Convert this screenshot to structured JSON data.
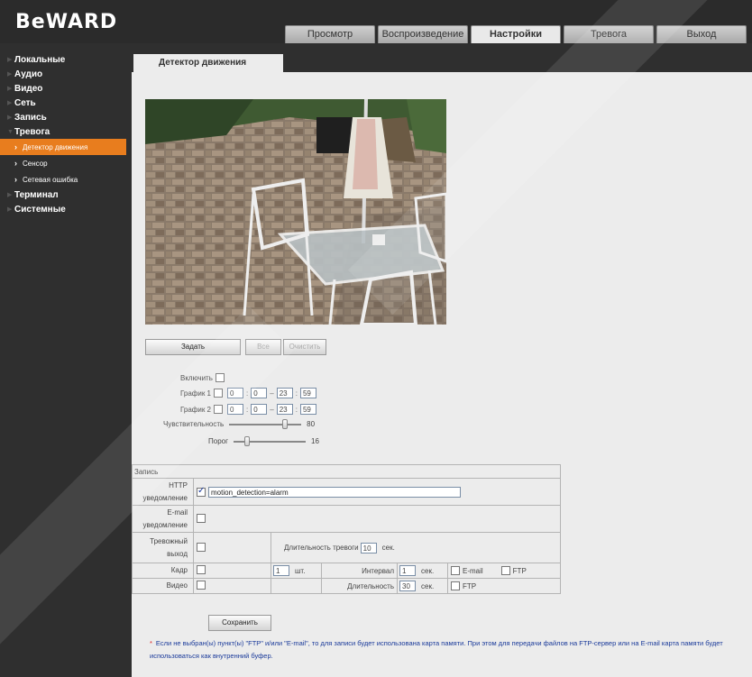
{
  "brand": {
    "logo": "BeWARD"
  },
  "top_tabs": [
    "Просмотр",
    "Воспроизведение",
    "Настройки",
    "Тревога",
    "Выход"
  ],
  "active_top_tab": "Настройки",
  "sidebar": {
    "items": [
      "Локальные",
      "Аудио",
      "Видео",
      "Сеть",
      "Запись",
      "Тревога"
    ],
    "sub_items": [
      "Детектор движения",
      "Сенсор",
      "Сетевая ошибка"
    ],
    "items_after": [
      "Терминал",
      "Системные"
    ]
  },
  "page": {
    "title": "Детектор движения"
  },
  "area_buttons": {
    "set": "Задать",
    "all": "Все",
    "clear": "Очистить"
  },
  "form": {
    "enable_label": "Включить",
    "schedule1_label": "График 1",
    "schedule1": {
      "h_from": "0",
      "m_from": "0",
      "h_to": "23",
      "m_to": "59"
    },
    "schedule2_label": "График 2",
    "schedule2": {
      "h_from": "0",
      "m_from": "0",
      "h_to": "23",
      "m_to": "59"
    },
    "sensitivity_label": "Чувствительность",
    "sensitivity_value": "80",
    "sensitivity_level": 80,
    "threshold_label": "Порог",
    "threshold_value": "16",
    "threshold_level": 16
  },
  "recording": {
    "section_label": "Запись",
    "http_label_1": "HTTP",
    "http_label_2": "уведомление",
    "http_value": "motion_detection=alarm",
    "email_label_1": "E-mail",
    "email_label_2": "уведомление",
    "alarm_out_label_1": "Тревожный",
    "alarm_out_label_2": "выход",
    "alarm_duration_label": "Длительность тревоги",
    "alarm_duration_value": "10",
    "sec": "сек.",
    "frame_label": "Кадр",
    "frame_count": "1",
    "pcs": "шт.",
    "interval_label": "Интервал",
    "interval_value": "1",
    "email_opt": "E-mail",
    "ftp_opt": "FTP",
    "video_label": "Видео",
    "duration_label": "Длительность",
    "duration_value": "30"
  },
  "save_button": "Сохранить",
  "note": {
    "star": "*",
    "text": "Если не выбран(ы) пункт(ы) \"FTP\" и/или \"E-mail\", то для записи будет использована карта памяти. При этом для передачи файлов на FTP-сервер или на E-mail карта памяти будет использоваться как внутренний буфер."
  }
}
